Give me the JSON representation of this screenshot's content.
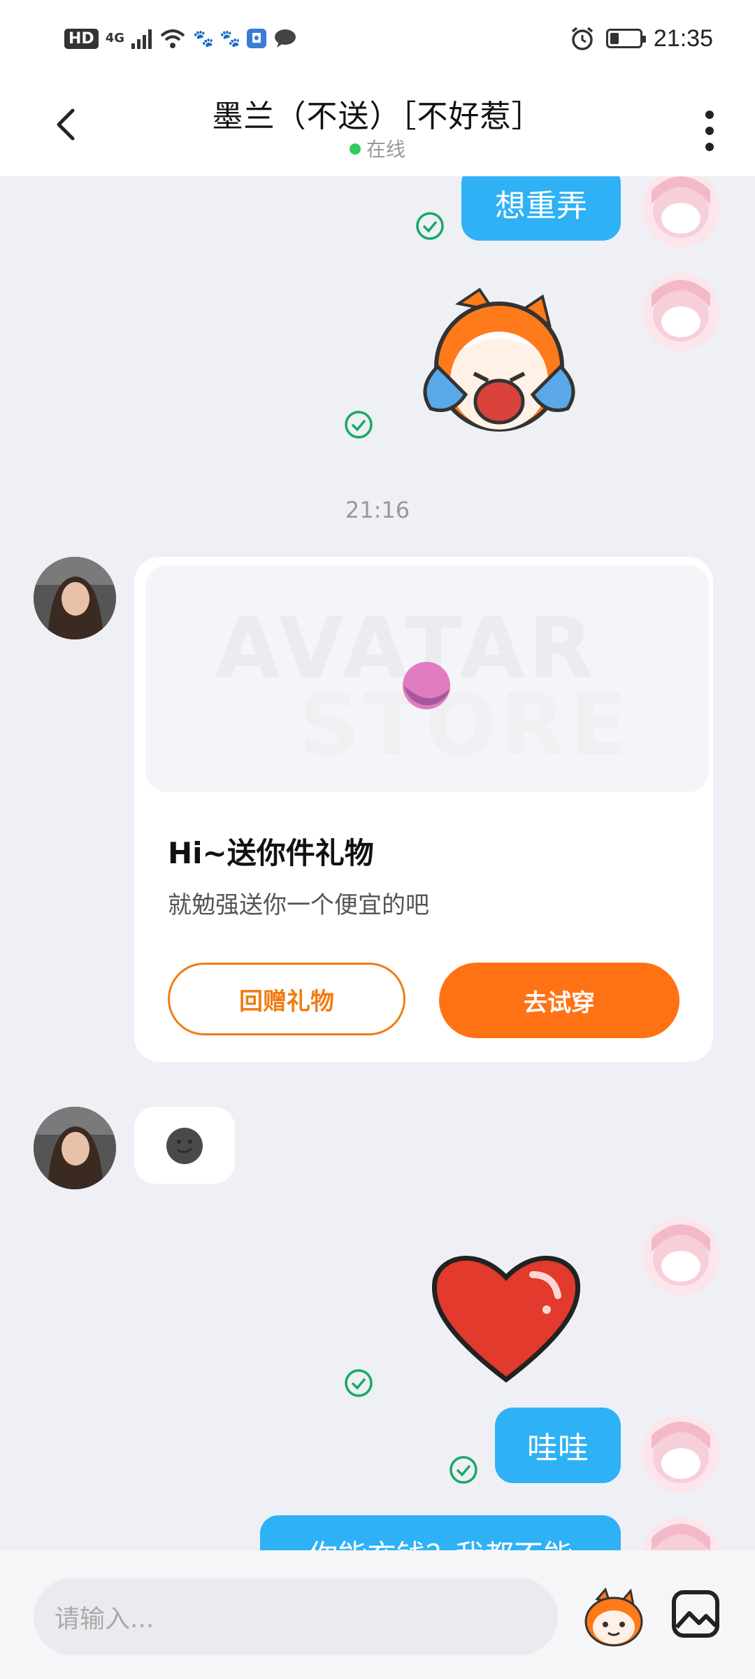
{
  "status_bar": {
    "hd": "HD",
    "network": "4G",
    "time": "21:35",
    "battery_level": 0.3
  },
  "header": {
    "title": "墨兰（不送）［不好惹］",
    "status": "在线"
  },
  "messages": {
    "m1_text": "想重弄",
    "timestamp": "21:16",
    "gift": {
      "watermark_line1": "AVATAR",
      "watermark_line2": "STORE",
      "title": "Hi~送你件礼物",
      "subtitle": "就勉强送你一个便宜的吧",
      "return_gift": "回赠礼物",
      "try_on": "去试穿"
    },
    "m_wawa": "哇哇",
    "m_last": "你能充钱？我都不能"
  },
  "input": {
    "placeholder": "请输入..."
  },
  "colors": {
    "bubble_blue": "#2fb1f5",
    "accent_orange": "#ff7214",
    "online_green": "#2ecc5a",
    "check_green": "#1aa867"
  }
}
